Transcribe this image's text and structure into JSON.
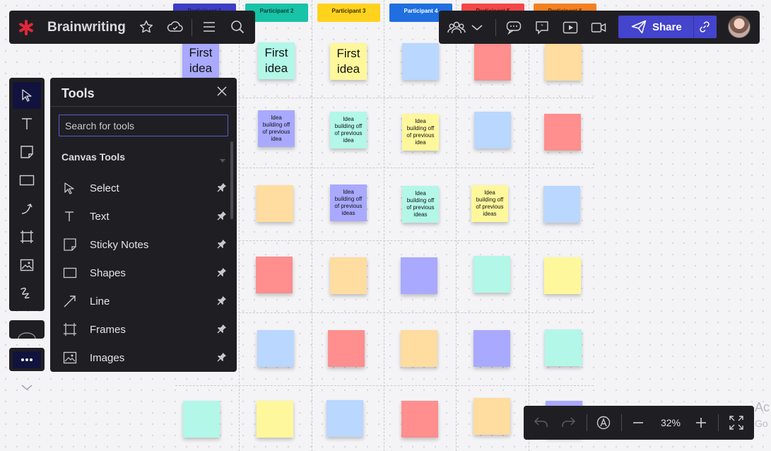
{
  "header": {
    "board_title": "Brainwriting",
    "logo_icon": "asterisk-logo-icon",
    "share_label": "Share"
  },
  "participants": [
    {
      "label": "Participant 1",
      "color": "#3d3dc5",
      "text_color": "#1b1b55"
    },
    {
      "label": "Participant 2",
      "color": "#18c3a7",
      "text_color": "#0f3d36"
    },
    {
      "label": "Participant 3",
      "color": "#ffd21e",
      "text_color": "#3a3000"
    },
    {
      "label": "Participant 4",
      "color": "#1f6fe0",
      "text_color": "#ffffff"
    },
    {
      "label": "Participant 5",
      "color": "#f44848",
      "text_color": "#5a0d0d"
    },
    {
      "label": "Participant 6",
      "color": "#f67f21",
      "text_color": "#5a2a00"
    }
  ],
  "stickies": {
    "first_idea": "First\nidea",
    "building_idea": "Idea\nbuilding off\nof previous\nidea",
    "building_ideas": "Idea\nbuilding off\nof previous\nideas",
    "colors": {
      "purple": "#a9a9ff",
      "teal": "#b2f7e8",
      "yellow": "#fff79c",
      "blue": "#b9d7ff",
      "red": "#ff8e8e",
      "orange": "#ffdca0"
    }
  },
  "tools_panel": {
    "title": "Tools",
    "search_placeholder": "Search for tools",
    "section_title": "Canvas Tools",
    "items": [
      {
        "label": "Select",
        "icon": "cursor-icon"
      },
      {
        "label": "Text",
        "icon": "text-icon"
      },
      {
        "label": "Sticky Notes",
        "icon": "sticky-note-icon"
      },
      {
        "label": "Shapes",
        "icon": "rectangle-icon"
      },
      {
        "label": "Line",
        "icon": "line-arrow-icon"
      },
      {
        "label": "Frames",
        "icon": "frame-icon"
      },
      {
        "label": "Images",
        "icon": "image-icon"
      }
    ]
  },
  "zoom": {
    "level": "32%"
  },
  "activation_watermark": {
    "line1": "Ac",
    "line2": "Go"
  }
}
